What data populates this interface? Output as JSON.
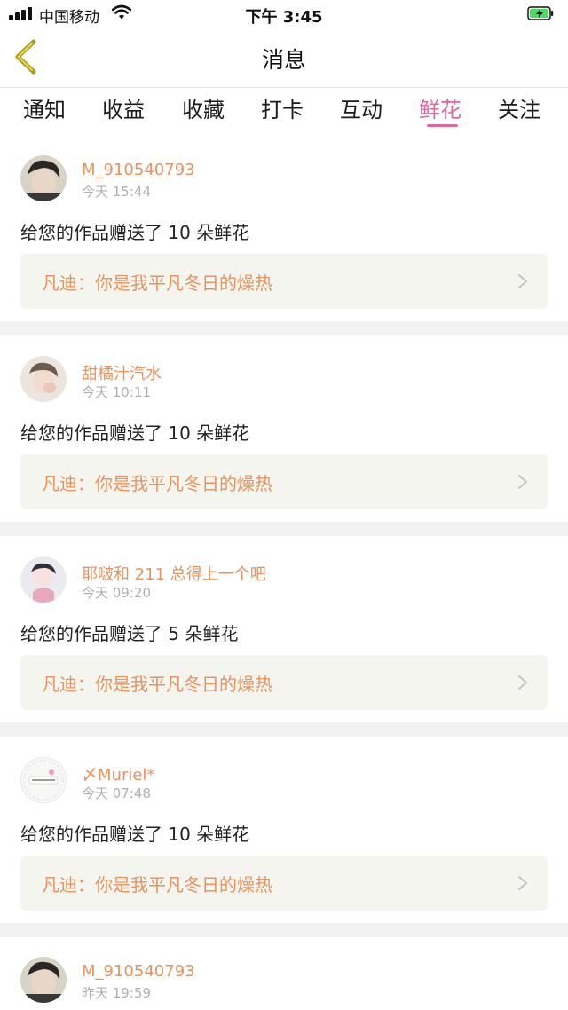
{
  "status_bar": {
    "carrier": "中国移动",
    "time": "下午 3:45"
  },
  "nav": {
    "title": "消息"
  },
  "tabs": [
    {
      "label": "通知"
    },
    {
      "label": "收益"
    },
    {
      "label": "收藏"
    },
    {
      "label": "打卡"
    },
    {
      "label": "互动"
    },
    {
      "label": "鲜花",
      "active": true
    },
    {
      "label": "关注"
    }
  ],
  "colors": {
    "accent_pink": "#e0669f",
    "username_orange": "#e8935e",
    "work_box_bg": "#f5f5ef"
  },
  "notifications": [
    {
      "username": "M_910540793",
      "time": "今天 15:44",
      "message": "给您的作品赠送了 10 朵鲜花",
      "work_title": "凡迪：你是我平凡冬日的燥热",
      "avatar": "avatar-photo-1"
    },
    {
      "username": "甜橘汁汽水",
      "time": "今天 10:11",
      "message": "给您的作品赠送了 10 朵鲜花",
      "work_title": "凡迪：你是我平凡冬日的燥热",
      "avatar": "avatar-photo-2"
    },
    {
      "username": "耶啵和 211 总得上一个吧",
      "time": "今天 09:20",
      "message": "给您的作品赠送了 5 朵鲜花",
      "work_title": "凡迪：你是我平凡冬日的燥热",
      "avatar": "avatar-photo-3"
    },
    {
      "username": "〆Muriel*",
      "time": "今天 07:48",
      "message": "给您的作品赠送了 10 朵鲜花",
      "work_title": "凡迪：你是我平凡冬日的燥热",
      "avatar": "avatar-photo-4"
    },
    {
      "username": "M_910540793",
      "time": "昨天 19:59",
      "avatar": "avatar-photo-1"
    }
  ]
}
